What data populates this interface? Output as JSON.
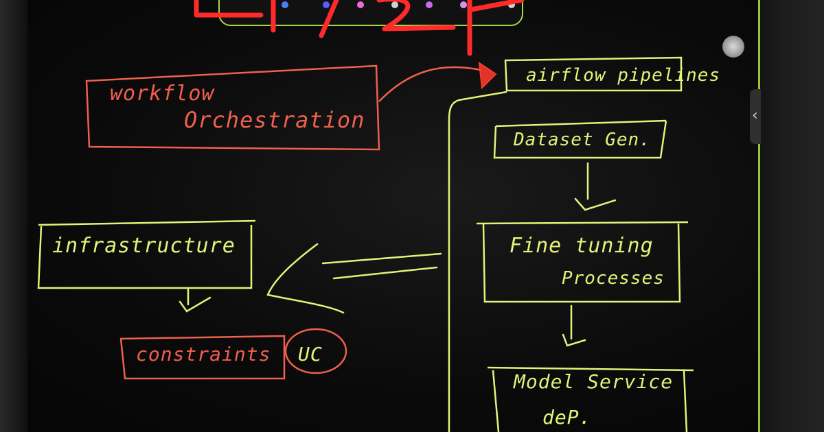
{
  "colors": {
    "yellow_ink": "#e4f27a",
    "red_ink": "#f0604d",
    "bright_red": "#ff2a2a",
    "green_edge": "#b6e23a"
  },
  "nodes": {
    "workflow": {
      "line1": "workflow",
      "line2": "Orchestration"
    },
    "airflow": "airflow pipelines",
    "dataset": "Dataset Gen.",
    "finetune": {
      "line1": "Fine tuning",
      "line2": "Processes"
    },
    "model": {
      "line1": "Model Service",
      "line2": "deP."
    },
    "infra": "infrastructure",
    "constraints": "constraints",
    "uc": "UC"
  },
  "icons": {
    "scroll_handle": "chevron-left-icon"
  }
}
